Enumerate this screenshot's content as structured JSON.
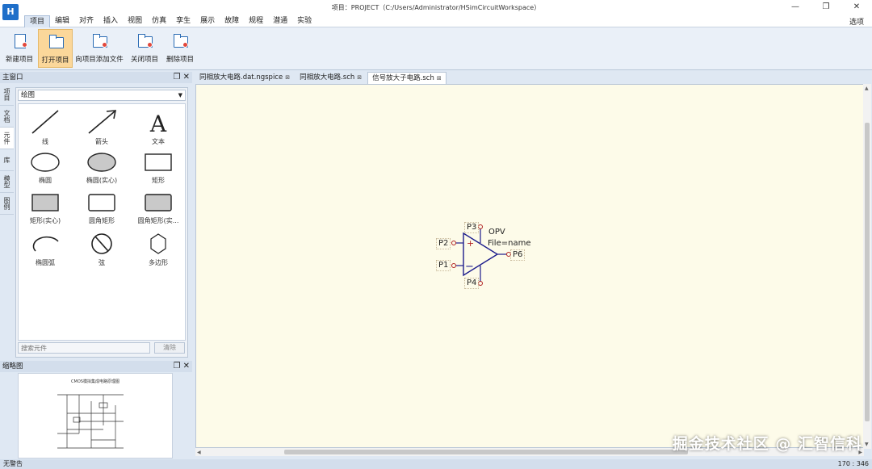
{
  "app": {
    "logo": "H",
    "window_title": "项目：PROJECT（C:/Users/Administrator/HSimCircuitWorkspace）"
  },
  "window_controls": {
    "minimize": "—",
    "restore": "❐",
    "close": "✕"
  },
  "menu": {
    "items": [
      "项目",
      "编辑",
      "对齐",
      "插入",
      "视图",
      "仿真",
      "孪生",
      "展示",
      "故障",
      "规程",
      "潜通",
      "实验"
    ],
    "active_index": 0,
    "options_label": "选项"
  },
  "ribbon": {
    "buttons": [
      {
        "label": "新建项目",
        "icon": "new-project-icon"
      },
      {
        "label": "打开项目",
        "icon": "open-folder-icon"
      },
      {
        "label": "向项目添加文件",
        "icon": "add-file-folder-icon"
      },
      {
        "label": "关闭项目",
        "icon": "close-folder-icon"
      },
      {
        "label": "删除项目",
        "icon": "delete-folder-icon"
      }
    ]
  },
  "main_panel": {
    "title": "主窗口",
    "vertical_tabs": [
      "项目",
      "文档",
      "元件",
      "库",
      "模型",
      "图例"
    ],
    "active_tab_index": 2,
    "category": "绘图",
    "tools": [
      {
        "label": "线",
        "icon": "line-icon"
      },
      {
        "label": "箭头",
        "icon": "arrow-icon"
      },
      {
        "label": "文本",
        "icon": "text-icon"
      },
      {
        "label": "椭圆",
        "icon": "ellipse-icon"
      },
      {
        "label": "椭圆(实心)",
        "icon": "filled-ellipse-icon"
      },
      {
        "label": "矩形",
        "icon": "rectangle-icon"
      },
      {
        "label": "矩形(实心)",
        "icon": "filled-rectangle-icon"
      },
      {
        "label": "圆角矩形",
        "icon": "rounded-rectangle-icon"
      },
      {
        "label": "圆角矩形(实...",
        "icon": "filled-rounded-rectangle-icon"
      },
      {
        "label": "椭圆弧",
        "icon": "elliptic-arc-icon"
      },
      {
        "label": "弦",
        "icon": "chord-icon"
      },
      {
        "label": "多边形",
        "icon": "polygon-icon"
      }
    ],
    "search_placeholder": "搜索元件",
    "clear_label": "清除"
  },
  "thumbnail_panel": {
    "title": "缩略图",
    "preview_title": "CMOS模拟集成电路原理图"
  },
  "document_tabs": [
    {
      "label": "同相放大电路.dat.ngspice",
      "active": false
    },
    {
      "label": "同相放大电路.sch",
      "active": false
    },
    {
      "label": "信号放大子电路.sch",
      "active": true
    }
  ],
  "schematic": {
    "component_name": "OPV",
    "component_attr": "File=name",
    "pins": [
      "P3",
      "P2",
      "P1",
      "P4",
      "P6"
    ],
    "plus_sign": "+",
    "minus_sign": "−",
    "colors": {
      "body": "#1c1c8c",
      "pin": "#b02020",
      "canvas": "#fdfbe9"
    }
  },
  "status": {
    "left": "无警告",
    "right": "170 : 346"
  },
  "watermark": "掘金技术社区 @ 汇智信科"
}
